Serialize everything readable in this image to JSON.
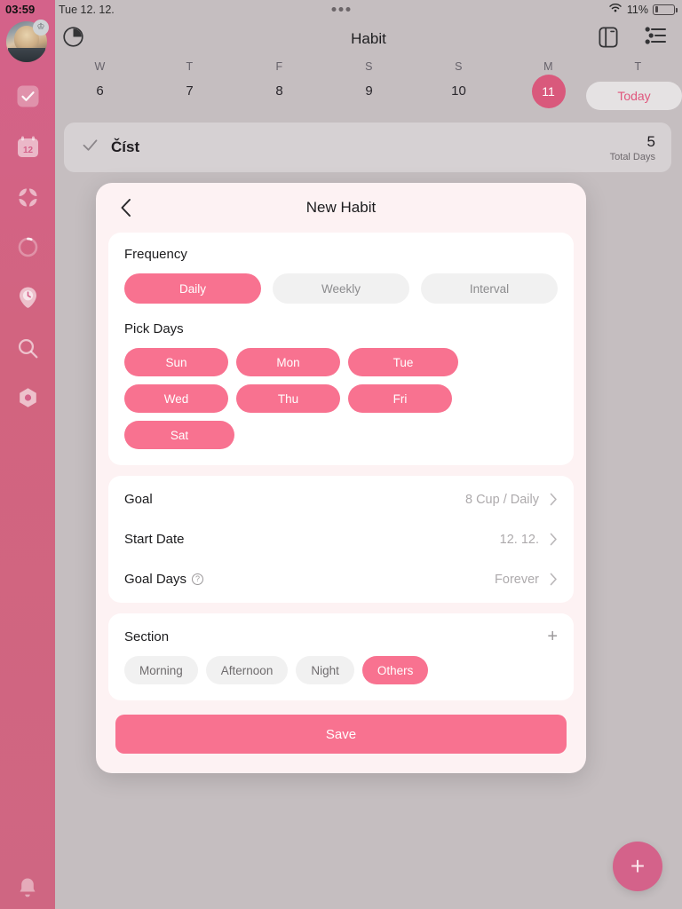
{
  "statusbar": {
    "time": "03:59",
    "date": "Tue 12. 12.",
    "battery_percent": "11%",
    "wifi_icon": "wifi-icon",
    "battery_icon": "battery-low-icon"
  },
  "sidebar": {
    "avatar_icon": "user-avatar",
    "crown_badge_icon": "crown-icon",
    "items": [
      {
        "name": "sidebar-item-habit",
        "icon": "checkbox-check-icon",
        "active": true
      },
      {
        "name": "sidebar-item-calendar",
        "icon": "calendar-12-icon",
        "active": false
      },
      {
        "name": "sidebar-item-widgets",
        "icon": "grid-four-petals-icon",
        "active": false
      },
      {
        "name": "sidebar-item-progress",
        "icon": "progress-ring-icon",
        "active": false
      },
      {
        "name": "sidebar-item-timer",
        "icon": "clock-pin-icon",
        "active": false
      },
      {
        "name": "sidebar-item-search",
        "icon": "search-icon",
        "active": false
      },
      {
        "name": "sidebar-item-settings",
        "icon": "hexagon-gear-icon",
        "active": false
      }
    ],
    "bottom_item": {
      "name": "sidebar-item-notifications",
      "icon": "bell-icon"
    }
  },
  "topbar": {
    "title": "Habit",
    "left_icon": "pie-clock-icon",
    "right_icons": [
      "sidebar-toggle-icon",
      "filter-sliders-icon"
    ]
  },
  "weekstrip": {
    "days": [
      {
        "dow": "W",
        "num": "6",
        "selected": false
      },
      {
        "dow": "T",
        "num": "7",
        "selected": false
      },
      {
        "dow": "F",
        "num": "8",
        "selected": false
      },
      {
        "dow": "S",
        "num": "9",
        "selected": false
      },
      {
        "dow": "S",
        "num": "10",
        "selected": false
      },
      {
        "dow": "M",
        "num": "11",
        "selected": true
      },
      {
        "dow": "T",
        "num": "",
        "selected": false
      }
    ],
    "today_label": "Today"
  },
  "habit_row": {
    "check_icon": "check-icon",
    "name": "Číst",
    "count": "5",
    "count_label": "Total Days"
  },
  "fab": {
    "icon": "plus-icon",
    "label": "+"
  },
  "modal": {
    "back_icon": "chevron-left-icon",
    "title": "New Habit",
    "frequency": {
      "label": "Frequency",
      "options": [
        {
          "label": "Daily",
          "selected": true
        },
        {
          "label": "Weekly",
          "selected": false
        },
        {
          "label": "Interval",
          "selected": false
        }
      ]
    },
    "pick_days": {
      "label": "Pick Days",
      "days": [
        {
          "label": "Sun",
          "selected": true
        },
        {
          "label": "Mon",
          "selected": true
        },
        {
          "label": "Tue",
          "selected": true
        },
        {
          "label": "Wed",
          "selected": true
        },
        {
          "label": "Thu",
          "selected": true
        },
        {
          "label": "Fri",
          "selected": true
        },
        {
          "label": "Sat",
          "selected": true
        }
      ]
    },
    "details": [
      {
        "label": "Goal",
        "value": "8 Cup / Daily",
        "info": false
      },
      {
        "label": "Start Date",
        "value": "12. 12.",
        "info": false
      },
      {
        "label": "Goal Days",
        "value": "Forever",
        "info": true
      }
    ],
    "section": {
      "label": "Section",
      "add_icon": "plus-icon",
      "add_label": "+",
      "chips": [
        {
          "label": "Morning",
          "selected": false
        },
        {
          "label": "Afternoon",
          "selected": false
        },
        {
          "label": "Night",
          "selected": false
        },
        {
          "label": "Others",
          "selected": true
        }
      ]
    },
    "save_label": "Save"
  },
  "colors": {
    "accent_pink": "#f87290",
    "sidebar_pink": "#d4628a",
    "today_pink": "#e0567d",
    "modal_bg": "#fdf2f3",
    "dim_bg": "#c5bec0"
  }
}
